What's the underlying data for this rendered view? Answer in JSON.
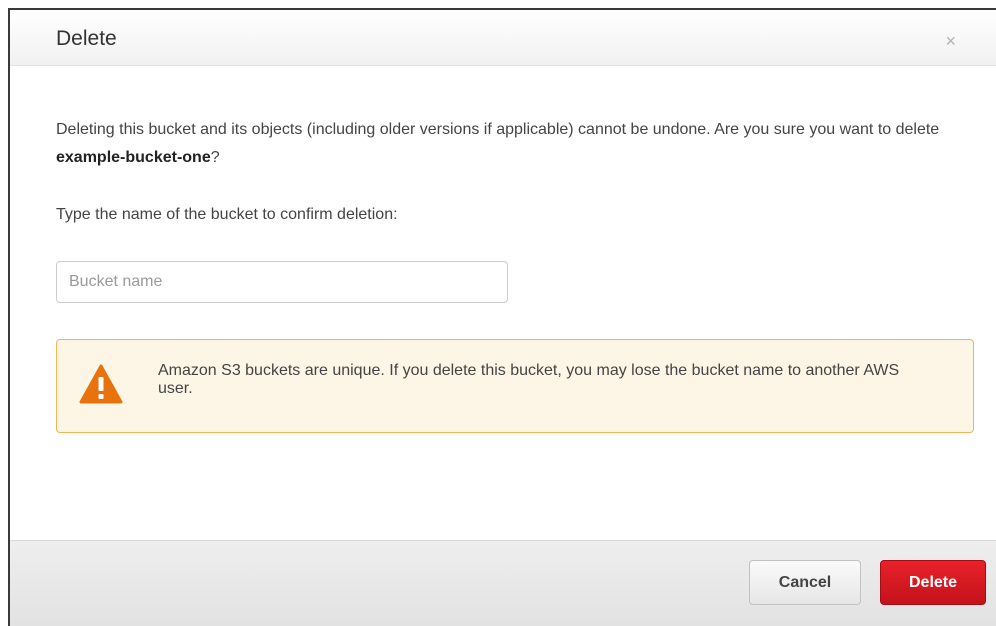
{
  "dialog": {
    "title": "Delete",
    "close_symbol": "×",
    "message_before": "Deleting this bucket and its objects (including older versions if applicable) cannot be undone. Are you sure you want to delete ",
    "bucket_name": "example-bucket-one",
    "message_after": "?",
    "confirm_label": "Type the name of the bucket to confirm deletion:",
    "input": {
      "value": "",
      "placeholder": "Bucket name"
    },
    "warning": {
      "icon": "warning-triangle-icon",
      "text": "Amazon S3 buckets are unique. If you delete this bucket, you may lose the bucket name to another AWS user."
    },
    "buttons": {
      "cancel_label": "Cancel",
      "delete_label": "Delete"
    }
  },
  "colors": {
    "danger": "#d4161f",
    "warning_icon": "#e8720c",
    "warning_border": "#f0b55a",
    "warning_background": "#fdf6e6"
  }
}
